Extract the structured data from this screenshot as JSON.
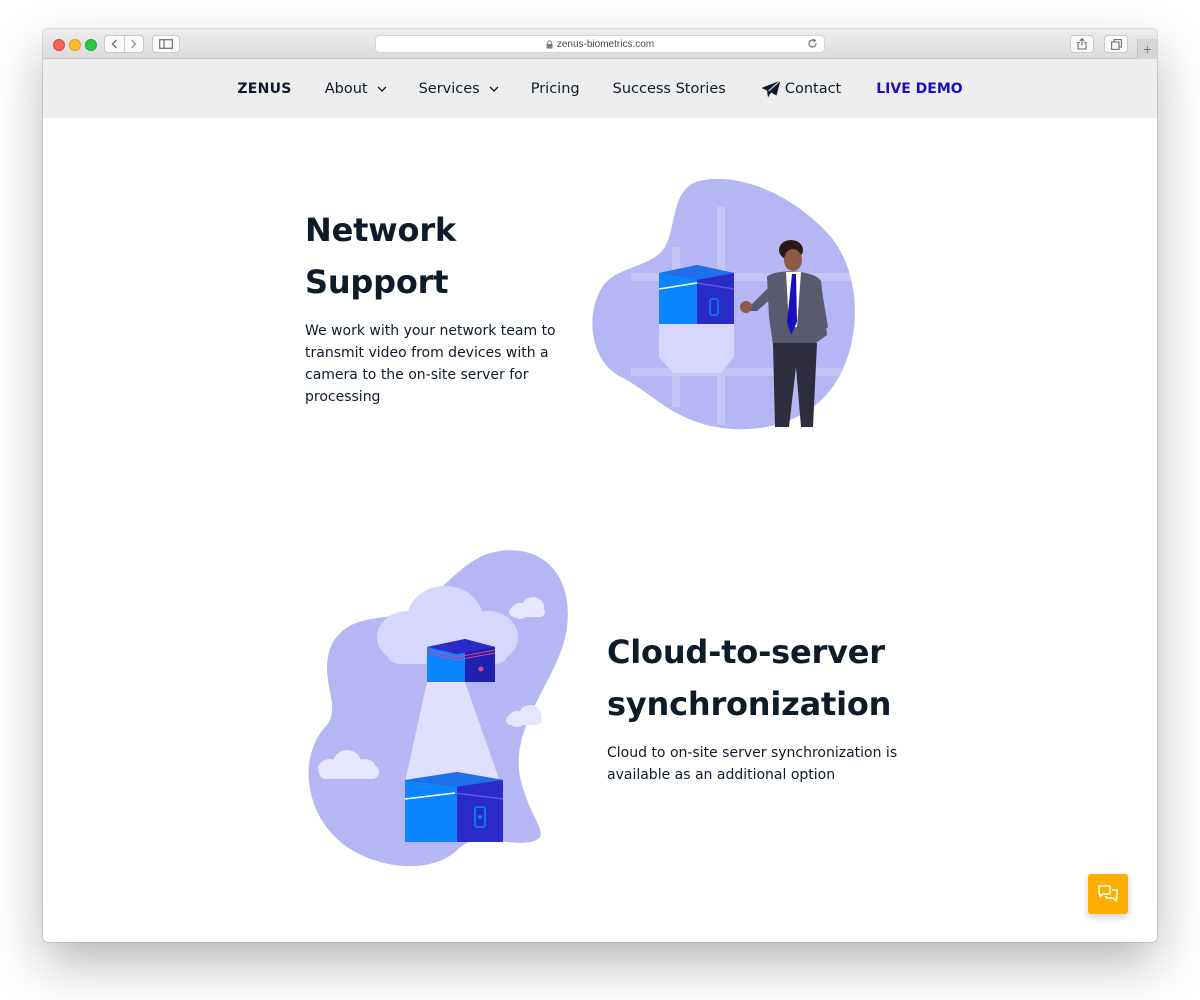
{
  "browser": {
    "url": "zenus-biometrics.com",
    "new_tab": "+"
  },
  "nav": {
    "logo": "ZENUS",
    "about": "About",
    "services": "Services",
    "pricing": "Pricing",
    "success_stories": "Success Stories",
    "contact": "Contact",
    "live_demo": "LIVE DEMO"
  },
  "sections": [
    {
      "title_line1": "Network",
      "title_line2": "Support",
      "body": "We work with your network team to transmit video from devices with a camera to the on-site server for processing"
    },
    {
      "title_line1": "Cloud-to-server",
      "title_line2": "synchronization",
      "body": "Cloud to on-site server synchronization is available as an additional option"
    }
  ],
  "colors": {
    "accent": "#1a0fbf",
    "blob": "#b6b6f5",
    "server_front": "#0a84ff",
    "server_side": "#2b2bc7",
    "chat_button": "#ffae00"
  },
  "icons": {
    "chat": "chat-bubbles-icon",
    "contact": "paper-plane-icon"
  }
}
